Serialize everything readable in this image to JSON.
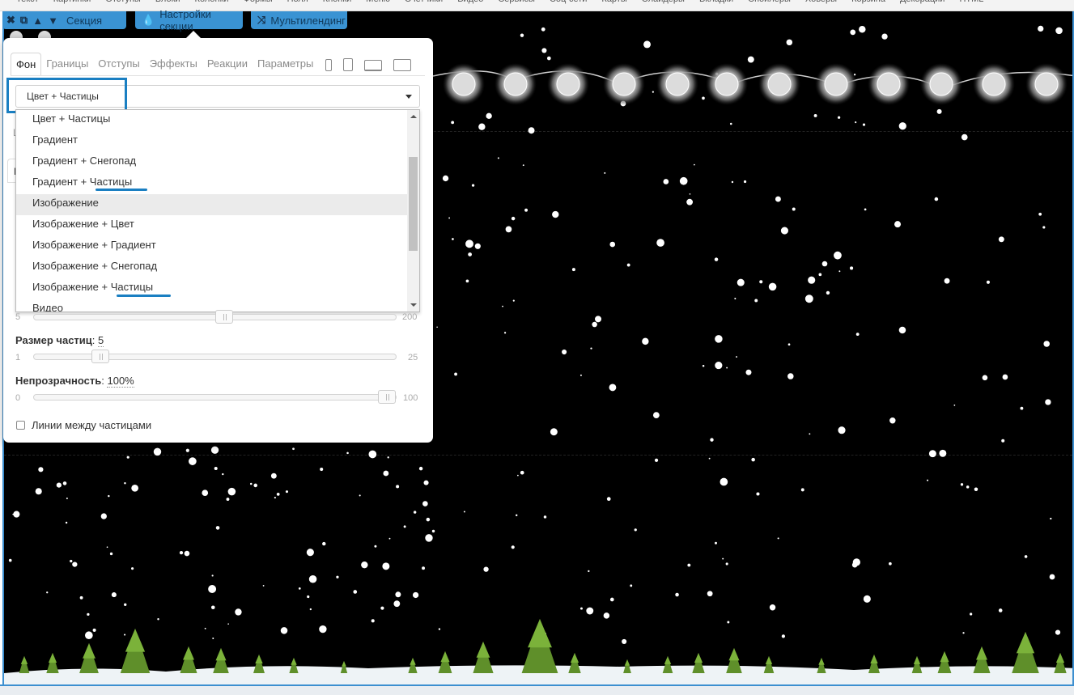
{
  "top_menu": [
    "Текст",
    "Картинки",
    "Отступы",
    "Блоки",
    "Колонки",
    "Формы",
    "Поля",
    "Кнопки",
    "Меню",
    "Счетчики",
    "Видео",
    "Сервисы",
    "Соц-сети",
    "Карты",
    "Слайдеры",
    "Вкладки",
    "Спойлеры",
    "Ховеры",
    "Корзина",
    "Декорации",
    "HTML"
  ],
  "toolbar": {
    "section_label": "Секция",
    "settings_label": "Настройки секции",
    "multilanding_label": "Мультилендинг"
  },
  "panel": {
    "tabs": [
      "Фон",
      "Границы",
      "Отступы",
      "Эффекты",
      "Реакции",
      "Параметры"
    ],
    "active_tab": "Фон",
    "background_select": {
      "value": "Цвет + Частицы",
      "options": [
        "Цвет + Частицы",
        "Градиент",
        "Градиент + Снегопад",
        "Градиент + Частицы",
        "Изображение",
        "Изображение + Цвет",
        "Изображение + Градиент",
        "Изображение + Снегопад",
        "Изображение + Частицы",
        "Видео"
      ],
      "hovered": "Изображение"
    },
    "hidden_tab_letter": "В",
    "hidden_row_letter": "L",
    "count_slider": {
      "min": "5",
      "max": "200",
      "value_fraction": 0.53
    },
    "size_slider": {
      "label": "Размер частиц",
      "value": "5",
      "min": "1",
      "max": "25",
      "value_fraction": 0.17
    },
    "opacity_slider": {
      "label": "Непрозрачность",
      "value": "100%",
      "min": "0",
      "max": "100",
      "value_fraction": 1.0
    },
    "lines_checkbox": {
      "label": "Линии между частицами",
      "checked": false
    }
  },
  "colors": {
    "accent": "#3a93d3",
    "highlight": "#1a7fc2",
    "canvas": "#000000"
  }
}
